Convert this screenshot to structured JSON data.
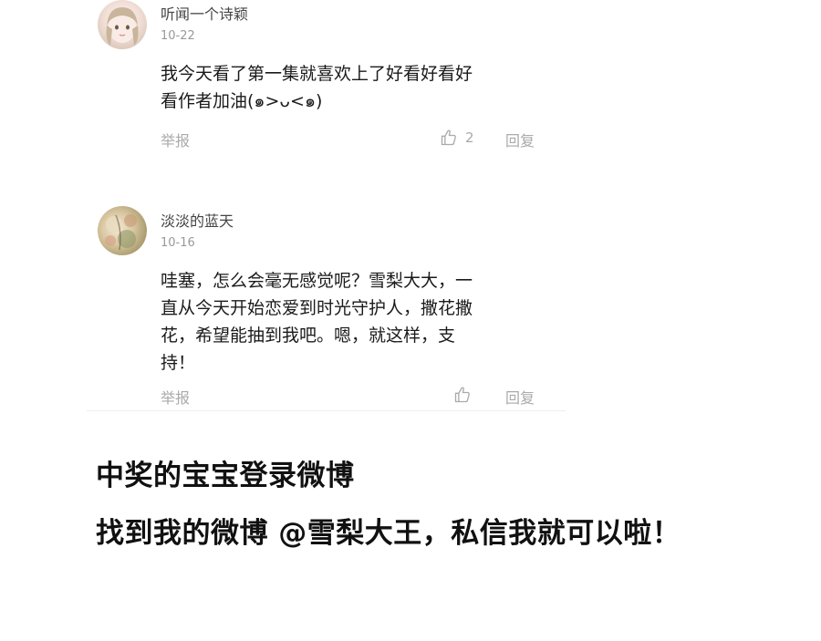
{
  "comments": [
    {
      "username": "听闻一个诗颖",
      "date": "10-22",
      "lines": [
        "我今天看了第一集就喜欢上了好看好看好",
        "看作者加油(๑>ᴗ<๑)"
      ],
      "report_label": "举报",
      "like_count": "2",
      "reply_label": "回复",
      "avatar_icon": "anime-girl-avatar"
    },
    {
      "username": "淡淡的蓝天",
      "date": "10-16",
      "lines": [
        "哇塞，怎么会毫无感觉呢？雪梨大大，一",
        "直从今天开始恋爱到时光守护人，撒花撒",
        "花，希望能抽到我吧。嗯，就这样，支",
        "持！"
      ],
      "report_label": "举报",
      "like_count": "",
      "reply_label": "回复",
      "avatar_icon": "floral-painting-avatar"
    }
  ],
  "notice": {
    "line1": "中奖的宝宝登录微博",
    "line2": "找到我的微博 @雪梨大王，私信我就可以啦！"
  }
}
